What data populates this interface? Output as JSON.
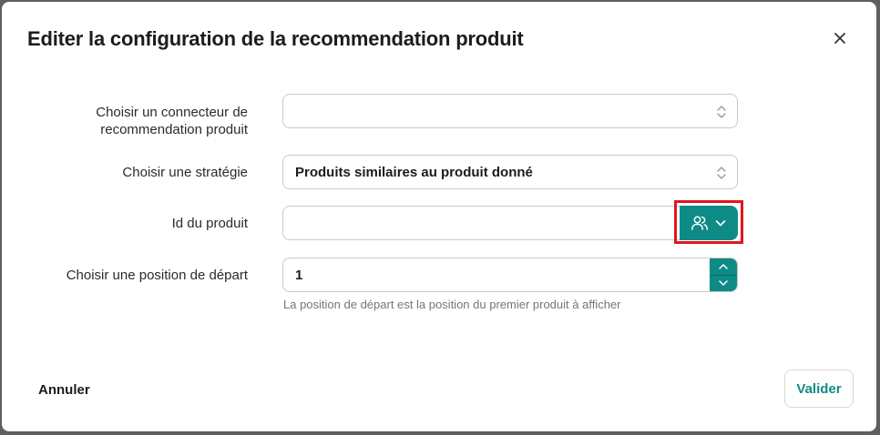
{
  "dialog": {
    "title": "Editer la configuration de la recommendation produit",
    "close_icon": "close-icon"
  },
  "form": {
    "connector": {
      "label_line1": "Choisir un connecteur de",
      "label_line2": "recommendation produit",
      "value": ""
    },
    "strategy": {
      "label": "Choisir une stratégie",
      "value": "Produits similaires au produit donné"
    },
    "product_id": {
      "label": "Id du produit",
      "value": "",
      "picker_icon": "users-icon",
      "picker_chevron": "chevron-down-icon"
    },
    "start_position": {
      "label": "Choisir une position de départ",
      "value": "1",
      "hint": "La position de départ est la position du premier produit à afficher"
    }
  },
  "footer": {
    "cancel_label": "Annuler",
    "validate_label": "Valider"
  },
  "colors": {
    "accent": "#0e8b86",
    "highlight": "#e0161c"
  }
}
